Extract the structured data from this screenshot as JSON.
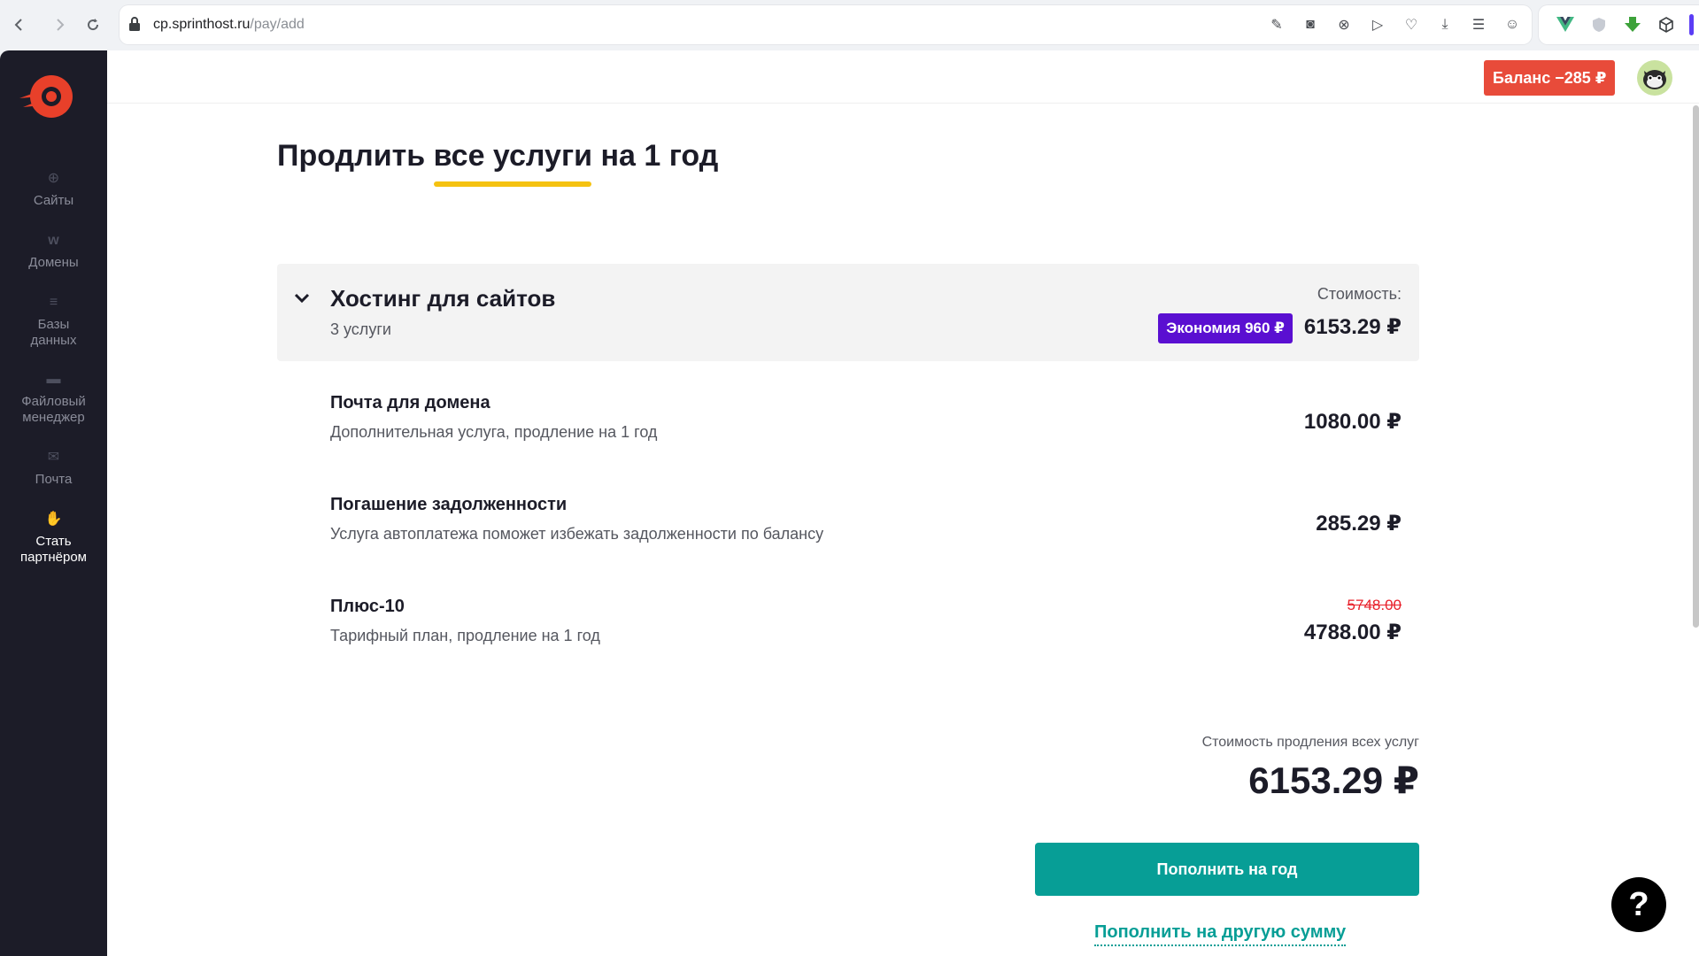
{
  "browser": {
    "url_domain": "cp.sprinthost.ru",
    "url_path": "/pay/add"
  },
  "sidebar": {
    "items": [
      {
        "label": "Сайты",
        "icon": "globe-icon"
      },
      {
        "label": "Домены",
        "icon": "domain-icon"
      },
      {
        "label": "Базы данных",
        "icon": "database-icon"
      },
      {
        "label": "Файловый менеджер",
        "icon": "folder-icon"
      },
      {
        "label": "Почта",
        "icon": "mail-icon"
      },
      {
        "label": "Стать партнёром",
        "icon": "partner-icon"
      }
    ]
  },
  "header": {
    "balance": "Баланс −285 ₽"
  },
  "page": {
    "title": "Продлить все услуги на 1 год"
  },
  "group": {
    "title": "Хостинг для сайтов",
    "subtitle": "3 услуги",
    "cost_label": "Стоимость:",
    "saving_badge": "Экономия 960 ₽",
    "price": "6153.29 ₽"
  },
  "services": [
    {
      "name": "Почта для домена",
      "desc": "Дополнительная услуга, продление на 1 год",
      "price": "1080.00 ₽"
    },
    {
      "name": "Погашение задолженности",
      "desc": "Услуга автоплатежа поможет избежать задолженности по балансу",
      "price": "285.29 ₽"
    },
    {
      "name": "Плюс-10",
      "desc": "Тарифный план, продление на 1 год",
      "old_price": "5748.00",
      "price": "4788.00 ₽"
    }
  ],
  "summary": {
    "label": "Стоимость продления всех услуг",
    "total": "6153.29 ₽",
    "pay_button": "Пополнить на год",
    "other_link": "Пополнить на другую сумму"
  },
  "help": {
    "label": "?"
  },
  "colors": {
    "sidebar_bg": "#1c1c28",
    "accent_teal": "#079e96",
    "balance_red": "#e84b3a",
    "saving_purple": "#5a0fd1",
    "underline_yellow": "#f5c211"
  }
}
